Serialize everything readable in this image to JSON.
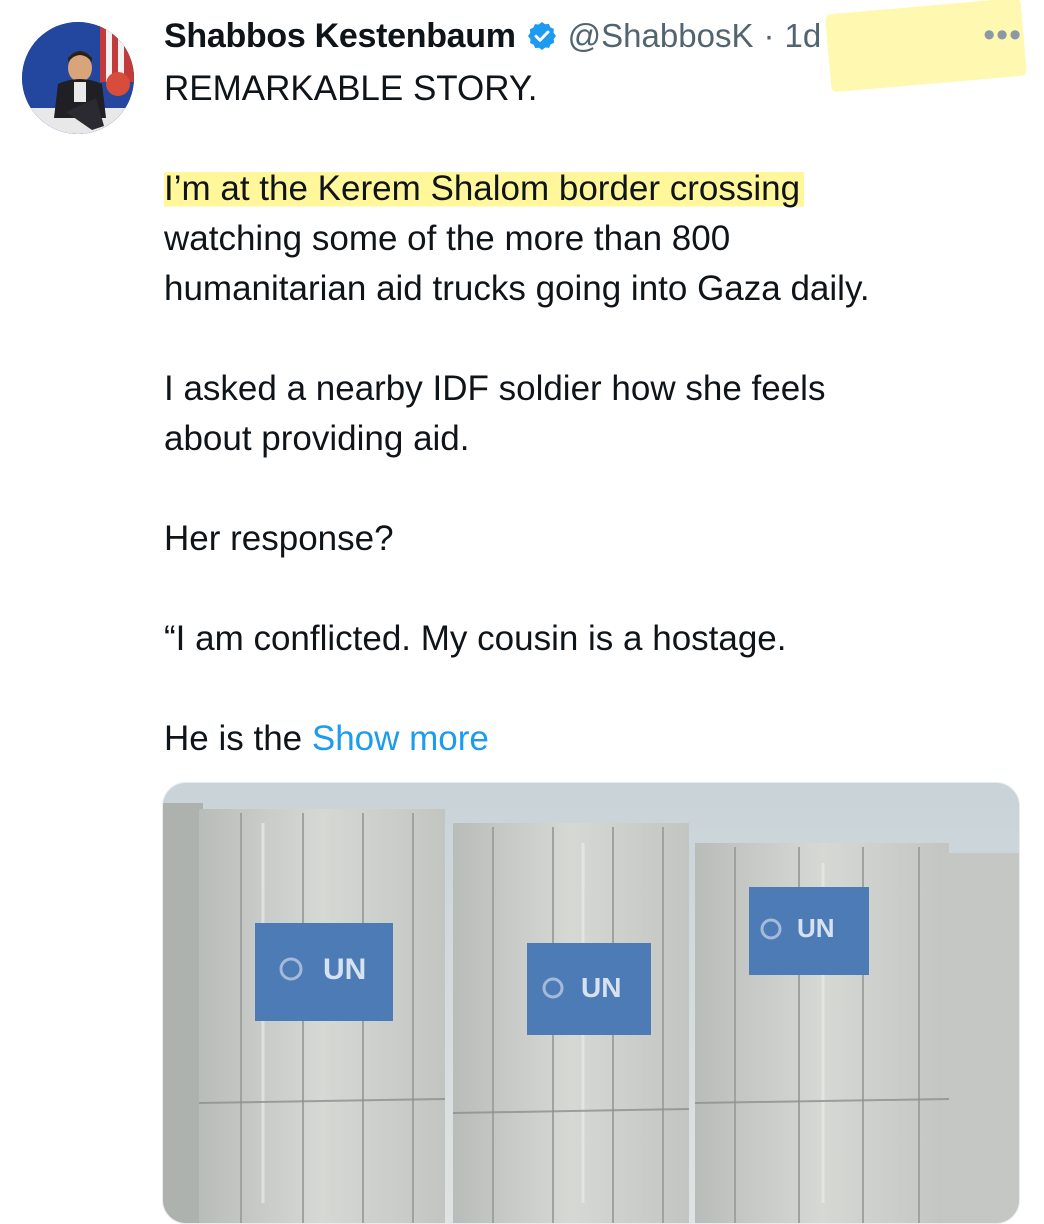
{
  "tweet": {
    "author_name": "Shabbos Kestenbaum",
    "handle": "@ShabbosK",
    "separator": "·",
    "time_ago": "1d",
    "more_glyph": "•••",
    "text_lines": [
      "REMARKABLE STORY.",
      "",
      "I’m at the Kerem Shalom border crossing",
      "watching some of the more than 800",
      "humanitarian aid trucks going into Gaza daily.",
      "",
      "I asked a nearby IDF soldier how she feels",
      "about providing aid.",
      "",
      "Her response?",
      "",
      "“I am conflicted. My cousin is a hostage.",
      "",
      "He is the"
    ],
    "show_more_label": "Show more",
    "media": {
      "sign_labels": [
        "UN",
        "UN",
        "UN"
      ]
    }
  },
  "colors": {
    "text": "#0f1419",
    "secondary": "#536471",
    "link": "#1d9bf0",
    "verified": "#1d9bf0",
    "highlight": "#fff046"
  }
}
